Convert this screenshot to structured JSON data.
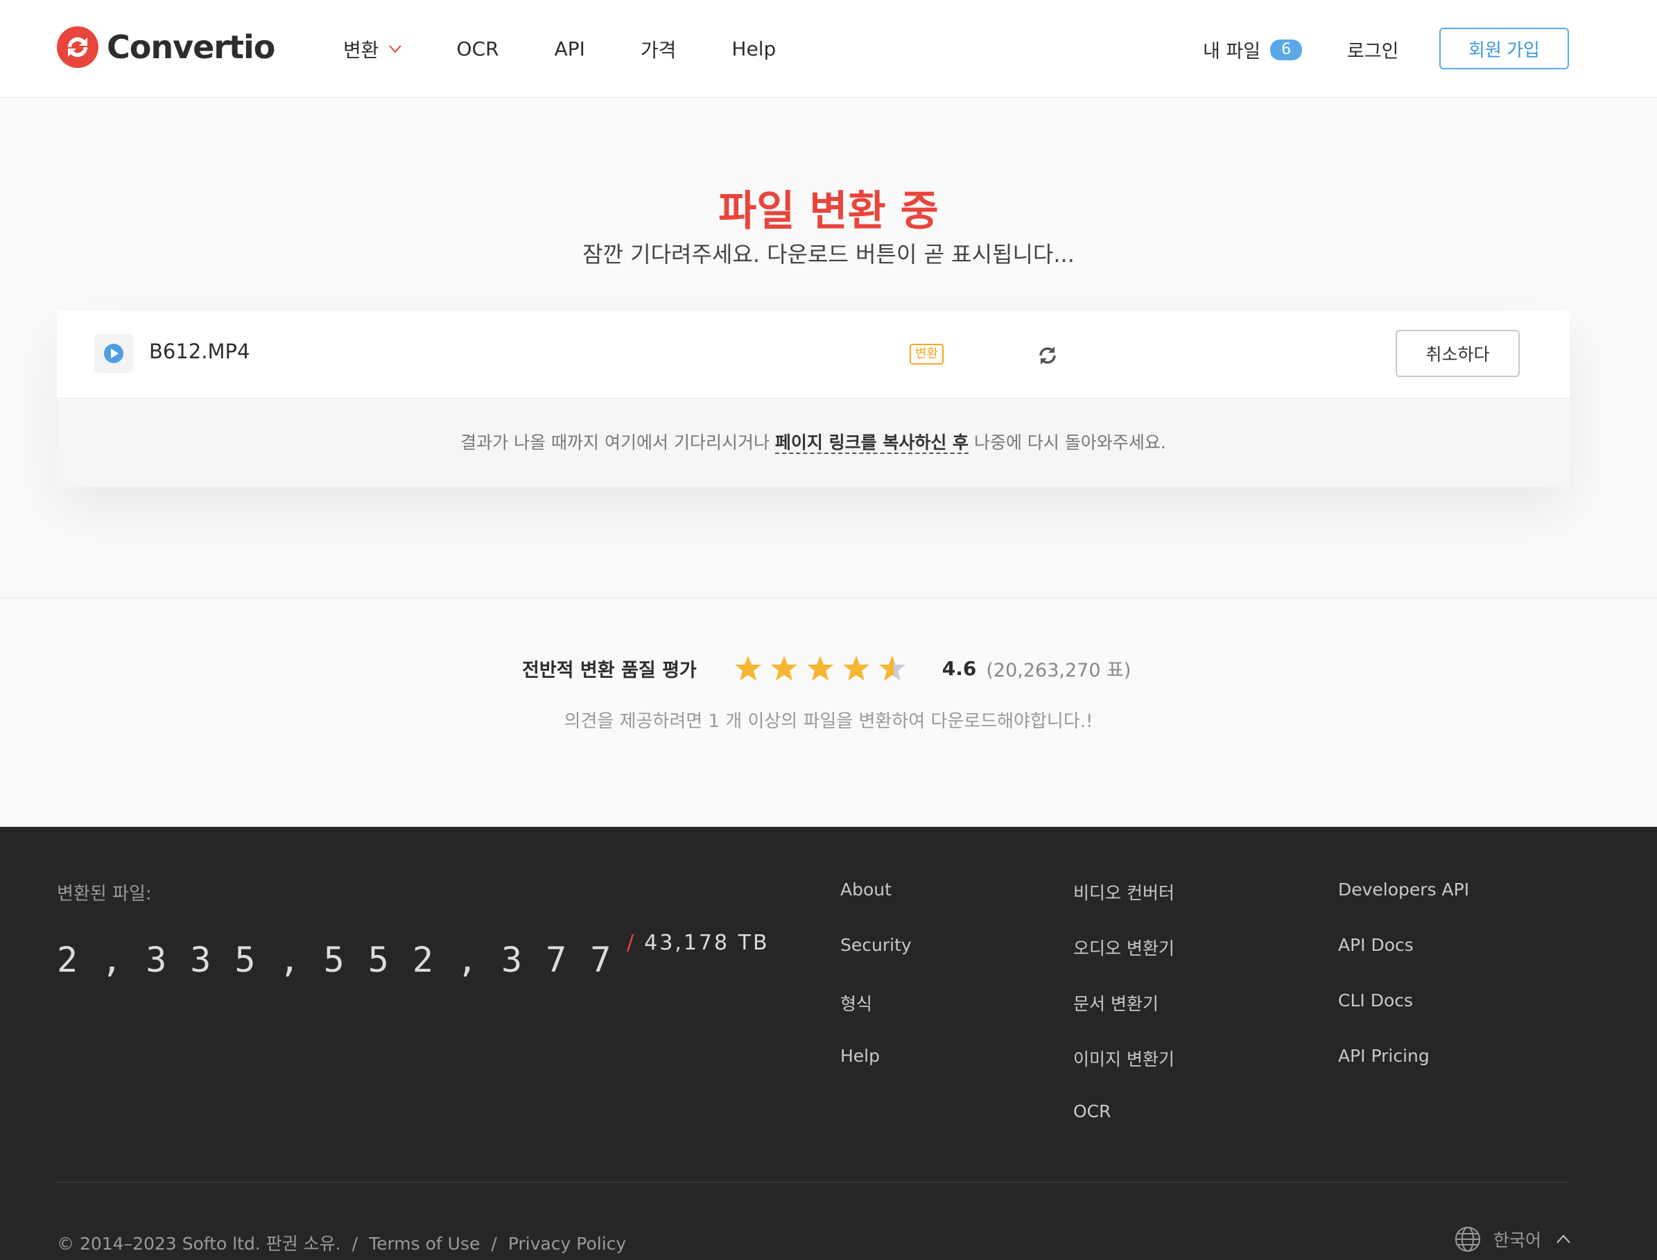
{
  "header": {
    "logo_text": "Convertio",
    "nav": [
      {
        "label": "변환",
        "has_dropdown": true
      },
      {
        "label": "OCR"
      },
      {
        "label": "API"
      },
      {
        "label": "가격"
      },
      {
        "label": "Help"
      }
    ],
    "my_files_label": "내 파일",
    "my_files_count": "6",
    "login_label": "로그인",
    "signup_label": "회원 가입"
  },
  "hero": {
    "title": "파일 변환 중",
    "subtitle": "잠깐 기다려주세요. 다운로드 버튼이 곧 표시됩니다..."
  },
  "file": {
    "name": "B612.MP4",
    "status": "변환",
    "cancel_label": "취소하다"
  },
  "note": {
    "before": "결과가 나올 때까지 여기에서 기다리시거나 ",
    "link": "페이지 링크를 복사하신 후",
    "after": " 나중에 다시 돌아와주세요."
  },
  "rating": {
    "label": "전반적 변환 품질 평가",
    "score": "4.6",
    "score_value": 4.6,
    "votes": "(20,263,270 표)",
    "note": "의견을 제공하려면 1 개 이상의 파일을 변환하여 다운로드해야합니다.!"
  },
  "footer": {
    "converted_label": "변환된 파일:",
    "counter": "2,335,552,377",
    "tb": "43,178 TB",
    "col1": [
      "About",
      "Security",
      "형식",
      "Help"
    ],
    "col2": [
      "비디오 컨버터",
      "오디오 변환기",
      "문서 변환기",
      "이미지 변환기",
      "OCR"
    ],
    "col3": [
      "Developers API",
      "API Docs",
      "CLI Docs",
      "API Pricing"
    ],
    "copyright": "© 2014–2023 Softo ltd. 판권 소유.",
    "terms": "Terms of Use",
    "privacy": "Privacy Policy",
    "language": "한국어"
  },
  "colors": {
    "brand_red": "#e8453c",
    "accent_blue": "#5aa9e6",
    "star": "#f5b731",
    "footer_bg": "#262626"
  }
}
